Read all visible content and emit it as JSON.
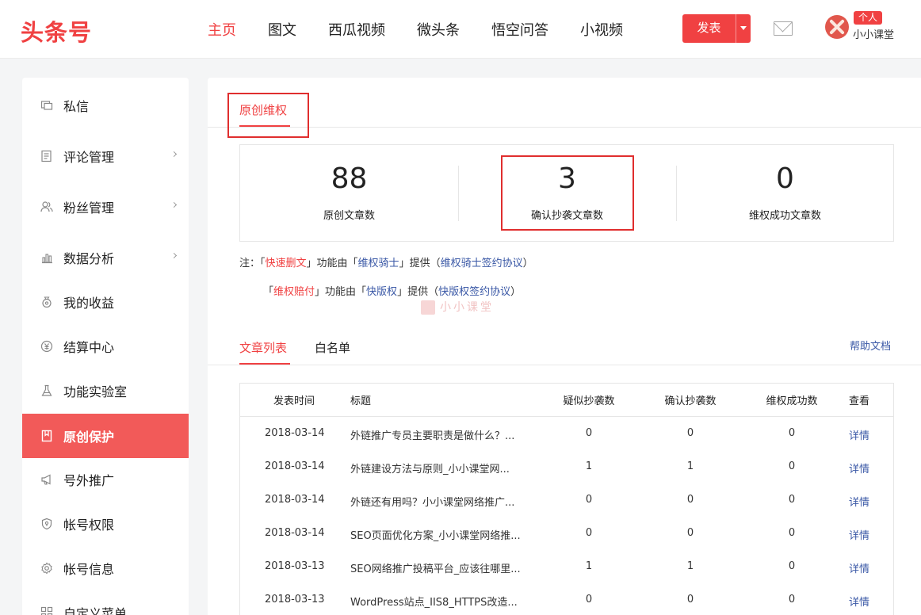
{
  "header": {
    "logo": "头条号",
    "nav": [
      "主页",
      "图文",
      "西瓜视频",
      "微头条",
      "悟空问答",
      "小视频"
    ],
    "publish_label": "发表",
    "badge": "个人",
    "username": "小小课堂"
  },
  "sidebar": {
    "items": [
      {
        "label": "私信",
        "icon": "message-icon"
      },
      {
        "label": "评论管理",
        "icon": "comment-icon"
      },
      {
        "label": "粉丝管理",
        "icon": "fans-icon"
      },
      {
        "label": "数据分析",
        "icon": "chart-icon"
      },
      {
        "label": "我的收益",
        "icon": "income-icon"
      },
      {
        "label": "结算中心",
        "icon": "settlement-icon"
      },
      {
        "label": "功能实验室",
        "icon": "flask-icon"
      },
      {
        "label": "原创保护",
        "icon": "bookmark-icon"
      },
      {
        "label": "号外推广",
        "icon": "megaphone-icon"
      },
      {
        "label": "帐号权限",
        "icon": "shield-icon"
      },
      {
        "label": "帐号信息",
        "icon": "gear-icon"
      },
      {
        "label": "自定义菜单",
        "icon": "grid-icon"
      }
    ],
    "active": "原创保护"
  },
  "main": {
    "tab": "原创维权",
    "stats": [
      {
        "value": "88",
        "label": "原创文章数"
      },
      {
        "value": "3",
        "label": "确认抄袭文章数"
      },
      {
        "value": "0",
        "label": "维权成功文章数"
      }
    ],
    "note1": {
      "prefix": "注：「",
      "feature": "快速删文",
      "mid": "」功能由「",
      "provider": "维权骑士",
      "mid2": "」提供（",
      "agreement": "维权骑士签约协议",
      "suffix": "）"
    },
    "note2": {
      "prefix": "「",
      "feature": "维权赔付",
      "mid": "」功能由「",
      "provider": "快版权",
      "mid2": "」提供（",
      "agreement": "快版权签约协议",
      "suffix": "）"
    },
    "watermark": "小小课堂",
    "sub_tabs": [
      "文章列表",
      "白名单"
    ],
    "help_link": "帮助文档",
    "table": {
      "headers": [
        "发表时间",
        "标题",
        "疑似抄袭数",
        "确认抄袭数",
        "维权成功数",
        "查看"
      ],
      "rows": [
        {
          "date": "2018-03-14",
          "title": "外链推广专员主要职责是做什么？...",
          "suspected": "0",
          "confirmed": "0",
          "success": "0",
          "view": "详情"
        },
        {
          "date": "2018-03-14",
          "title": "外链建设方法与原则_小小课堂网...",
          "suspected": "1",
          "confirmed": "1",
          "success": "0",
          "view": "详情"
        },
        {
          "date": "2018-03-14",
          "title": "外链还有用吗？小小课堂网络推广...",
          "suspected": "0",
          "confirmed": "0",
          "success": "0",
          "view": "详情"
        },
        {
          "date": "2018-03-14",
          "title": "SEO页面优化方案_小小课堂网络推...",
          "suspected": "0",
          "confirmed": "0",
          "success": "0",
          "view": "详情"
        },
        {
          "date": "2018-03-13",
          "title": "SEO网络推广投稿平台_应该往哪里...",
          "suspected": "1",
          "confirmed": "1",
          "success": "0",
          "view": "详情"
        },
        {
          "date": "2018-03-13",
          "title": "WordPress站点_IIS8_HTTPS改造...",
          "suspected": "0",
          "confirmed": "0",
          "success": "0",
          "view": "详情"
        }
      ]
    }
  }
}
